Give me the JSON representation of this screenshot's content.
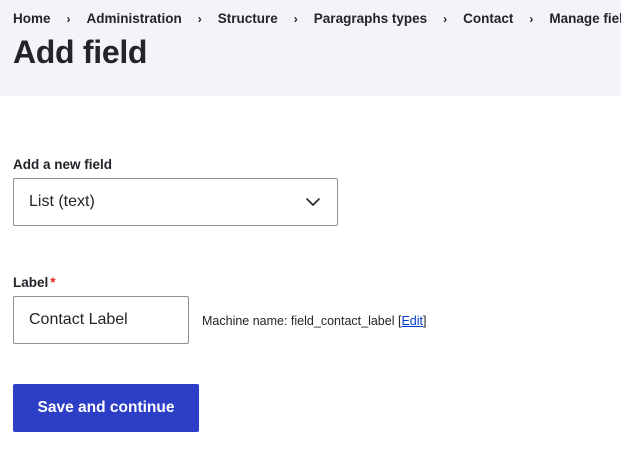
{
  "breadcrumb": {
    "items": [
      "Home",
      "Administration",
      "Structure",
      "Paragraphs types",
      "Contact",
      "Manage fields"
    ],
    "separator": "›"
  },
  "page": {
    "title": "Add field"
  },
  "new_field": {
    "label": "Add a new field",
    "selected_value": "List (text)",
    "icon": "chevron-down-icon"
  },
  "label_field": {
    "label": "Label",
    "required_marker": "*",
    "value": "Contact Label",
    "machine_name_prefix": "Machine name: field_contact_label ",
    "bracket_open": "[",
    "edit_link": "Edit",
    "bracket_close": "]"
  },
  "actions": {
    "save_label": "Save and continue"
  },
  "colors": {
    "header_bg": "#f3f4f9",
    "primary_button": "#2c3fc6",
    "link": "#003ecc",
    "required": "#dc2323"
  }
}
